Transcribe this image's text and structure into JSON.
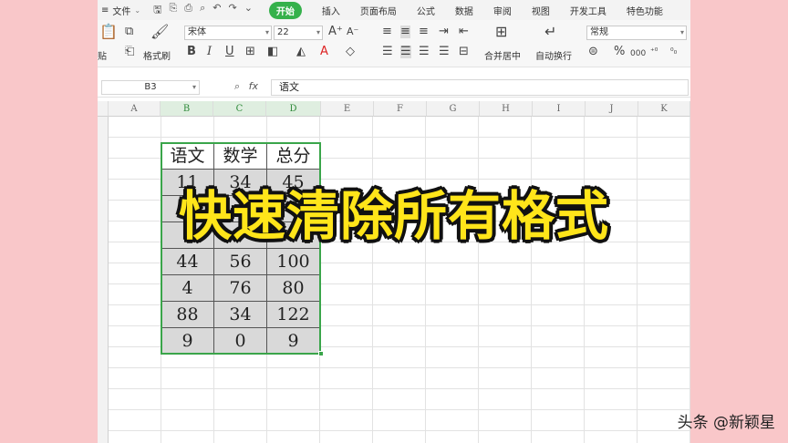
{
  "menubar": {
    "file_label": "文件",
    "tabs": [
      {
        "label": "开始",
        "active": true
      },
      {
        "label": "插入"
      },
      {
        "label": "页面布局"
      },
      {
        "label": "公式"
      },
      {
        "label": "数据"
      },
      {
        "label": "审阅"
      },
      {
        "label": "视图"
      },
      {
        "label": "开发工具"
      },
      {
        "label": "特色功能"
      }
    ]
  },
  "ribbon": {
    "paste_label": "贴",
    "format_painter_label": "格式刷",
    "font_name": "宋体",
    "font_size": "22",
    "merge_label": "合并居中",
    "wrap_label": "自动换行",
    "number_format": "常规",
    "bold": "B",
    "italic": "I",
    "underline": "U",
    "percent": "%",
    "comma": "000"
  },
  "formula_bar": {
    "cell_ref": "B3",
    "fx": "fx",
    "value": "语文"
  },
  "sheet": {
    "columns": [
      "A",
      "B",
      "C",
      "D",
      "E",
      "F",
      "G",
      "H",
      "I",
      "J",
      "K"
    ],
    "selected_columns": [
      "B",
      "C",
      "D"
    ],
    "table": {
      "headers": [
        "语文",
        "数学",
        "总分"
      ],
      "rows": [
        [
          "11",
          "34",
          "45"
        ],
        [
          "",
          "",
          ""
        ],
        [
          "",
          "",
          ""
        ],
        [
          "44",
          "56",
          "100"
        ],
        [
          "4",
          "76",
          "80"
        ],
        [
          "88",
          "34",
          "122"
        ],
        [
          "9",
          "0",
          "9"
        ]
      ]
    }
  },
  "overlay_caption": "快速清除所有格式",
  "watermark": "头条 @新颖星",
  "colors": {
    "accent_green": "#35b14b",
    "background_pink": "#f9c7c9",
    "caption_yellow": "#ffe51a"
  }
}
